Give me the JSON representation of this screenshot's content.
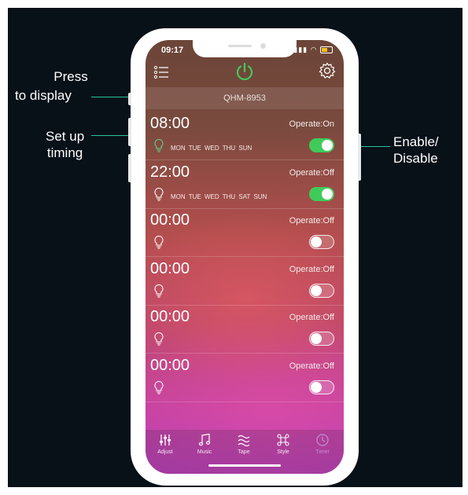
{
  "annotations": {
    "press": [
      "Press",
      "to display"
    ],
    "setup": [
      "Set up",
      "timing"
    ],
    "enable": [
      "Enable/",
      "Disable"
    ]
  },
  "status_bar": {
    "time": "09:17"
  },
  "top_bar": {
    "icons": [
      "list-icon",
      "power-icon",
      "gear-icon"
    ],
    "power_color": "#3fcb5a"
  },
  "device": {
    "name": "QHM-8953"
  },
  "timers": [
    {
      "time": "08:00",
      "operate": "Operate:On",
      "days": "MON TUE WED THU SUN",
      "enabled": true,
      "bulb_color": "#5fd08a"
    },
    {
      "time": "22:00",
      "operate": "Operate:Off",
      "days": "MON TUE WED THU SAT SUN",
      "enabled": true,
      "bulb_color": "#ffffff"
    },
    {
      "time": "00:00",
      "operate": "Operate:Off",
      "days": "",
      "enabled": false,
      "bulb_color": "#ffffff"
    },
    {
      "time": "00:00",
      "operate": "Operate:Off",
      "days": "",
      "enabled": false,
      "bulb_color": "#ffffff"
    },
    {
      "time": "00:00",
      "operate": "Operate:Off",
      "days": "",
      "enabled": false,
      "bulb_color": "#ffffff"
    },
    {
      "time": "00:00",
      "operate": "Operate:Off",
      "days": "",
      "enabled": false,
      "bulb_color": "#ffffff"
    }
  ],
  "tabs": [
    {
      "label": "Adjust",
      "icon": "sliders-icon"
    },
    {
      "label": "Music",
      "icon": "music-note-icon"
    },
    {
      "label": "Tape",
      "icon": "wave-icon"
    },
    {
      "label": "Style",
      "icon": "command-icon"
    },
    {
      "label": "Timer",
      "icon": "clock-icon",
      "active": true
    }
  ],
  "colors": {
    "accent": "#27c49a",
    "toggle_on": "#3fcb5a",
    "background": "#081018"
  }
}
